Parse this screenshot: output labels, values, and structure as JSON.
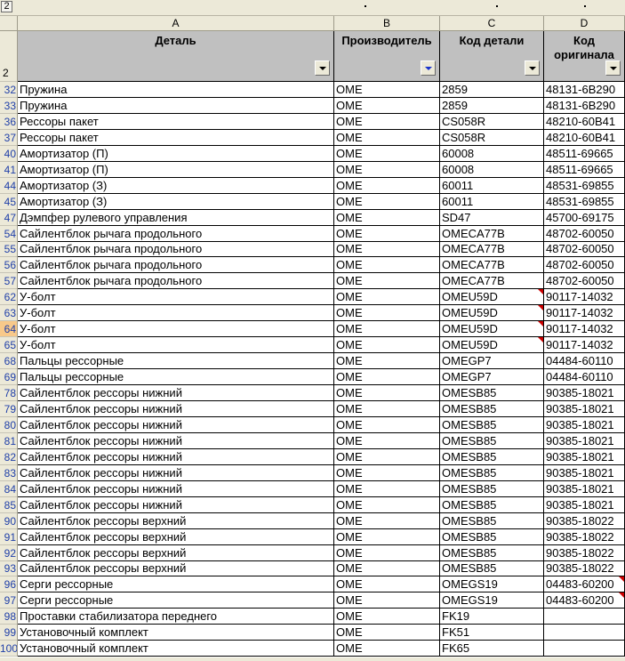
{
  "app": {
    "level_button": "2"
  },
  "columns": [
    "A",
    "B",
    "C",
    "D"
  ],
  "header_row_number": "2",
  "headers": [
    "Деталь",
    "Производитель",
    "Код детали",
    "Код оригинала"
  ],
  "rows": [
    {
      "n": "32",
      "a": "Пружина",
      "b": "OME",
      "c": "2859",
      "d": "48131-6B290"
    },
    {
      "n": "33",
      "a": "Пружина",
      "b": "OME",
      "c": "2859",
      "d": "48131-6B290"
    },
    {
      "n": "36",
      "a": "Рессоры пакет",
      "b": "OME",
      "c": "CS058R",
      "d": "48210-60B41"
    },
    {
      "n": "37",
      "a": "Рессоры пакет",
      "b": "OME",
      "c": "CS058R",
      "d": "48210-60B41"
    },
    {
      "n": "40",
      "a": "Амортизатор (П)",
      "b": "OME",
      "c": "60008",
      "d": "48511-69665"
    },
    {
      "n": "41",
      "a": "Амортизатор (П)",
      "b": "OME",
      "c": "60008",
      "d": "48511-69665"
    },
    {
      "n": "44",
      "a": "Амортизатор (З)",
      "b": "OME",
      "c": "60011",
      "d": "48531-69855"
    },
    {
      "n": "45",
      "a": "Амортизатор (З)",
      "b": "OME",
      "c": "60011",
      "d": "48531-69855"
    },
    {
      "n": "47",
      "a": "Дэмпфер рулевого управления",
      "b": "OME",
      "c": "SD47",
      "d": "45700-69175"
    },
    {
      "n": "54",
      "a": "Сайлентблок рычага продольного",
      "b": "OME",
      "c": "OMECA77B",
      "d": "48702-60050"
    },
    {
      "n": "55",
      "a": "Сайлентблок рычага продольного",
      "b": "OME",
      "c": "OMECA77B",
      "d": "48702-60050"
    },
    {
      "n": "56",
      "a": "Сайлентблок рычага продольного",
      "b": "OME",
      "c": "OMECA77B",
      "d": "48702-60050"
    },
    {
      "n": "57",
      "a": "Сайлентблок рычага продольного",
      "b": "OME",
      "c": "OMECA77B",
      "d": "48702-60050"
    },
    {
      "n": "62",
      "a": "У-болт",
      "b": "OME",
      "c": "OMEU59D",
      "d": "90117-14032"
    },
    {
      "n": "63",
      "a": "У-болт",
      "b": "OME",
      "c": "OMEU59D",
      "d": "90117-14032"
    },
    {
      "n": "64",
      "a": "У-болт",
      "b": "OME",
      "c": "OMEU59D",
      "d": "90117-14032"
    },
    {
      "n": "65",
      "a": "У-болт",
      "b": "OME",
      "c": "OMEU59D",
      "d": "90117-14032"
    },
    {
      "n": "68",
      "a": "Пальцы рессорные",
      "b": "OME",
      "c": "OMEGP7",
      "d": "04484-60110"
    },
    {
      "n": "69",
      "a": "Пальцы рессорные",
      "b": "OME",
      "c": "OMEGP7",
      "d": "04484-60110"
    },
    {
      "n": "78",
      "a": "Сайлентблок рессоры нижний",
      "b": "OME",
      "c": "OMESB85",
      "d": "90385-18021"
    },
    {
      "n": "79",
      "a": "Сайлентблок рессоры нижний",
      "b": "OME",
      "c": "OMESB85",
      "d": "90385-18021"
    },
    {
      "n": "80",
      "a": "Сайлентблок рессоры нижний",
      "b": "OME",
      "c": "OMESB85",
      "d": "90385-18021"
    },
    {
      "n": "81",
      "a": "Сайлентблок рессоры нижний",
      "b": "OME",
      "c": "OMESB85",
      "d": "90385-18021"
    },
    {
      "n": "82",
      "a": "Сайлентблок рессоры нижний",
      "b": "OME",
      "c": "OMESB85",
      "d": "90385-18021"
    },
    {
      "n": "83",
      "a": "Сайлентблок рессоры нижний",
      "b": "OME",
      "c": "OMESB85",
      "d": "90385-18021"
    },
    {
      "n": "84",
      "a": "Сайлентблок рессоры нижний",
      "b": "OME",
      "c": "OMESB85",
      "d": "90385-18021"
    },
    {
      "n": "85",
      "a": "Сайлентблок рессоры нижний",
      "b": "OME",
      "c": "OMESB85",
      "d": "90385-18021"
    },
    {
      "n": "90",
      "a": "Сайлентблок рессоры верхний",
      "b": "OME",
      "c": "OMESB85",
      "d": "90385-18022"
    },
    {
      "n": "91",
      "a": "Сайлентблок рессоры верхний",
      "b": "OME",
      "c": "OMESB85",
      "d": "90385-18022"
    },
    {
      "n": "92",
      "a": "Сайлентблок рессоры верхний",
      "b": "OME",
      "c": "OMESB85",
      "d": "90385-18022"
    },
    {
      "n": "93",
      "a": "Сайлентблок рессоры верхний",
      "b": "OME",
      "c": "OMESB85",
      "d": "90385-18022"
    },
    {
      "n": "96",
      "a": "Серги рессорные",
      "b": "OME",
      "c": "OMEGS19",
      "d": "04483-60200"
    },
    {
      "n": "97",
      "a": "Серги рессорные",
      "b": "OME",
      "c": "OMEGS19",
      "d": "04483-60200"
    },
    {
      "n": "98",
      "a": "Проставки стабилизатора переднего",
      "b": "OME",
      "c": "FK19",
      "d": ""
    },
    {
      "n": "99",
      "a": "Установочный комплект",
      "b": "OME",
      "c": "FK51",
      "d": ""
    },
    {
      "n": "100",
      "a": "Установочный комплект",
      "b": "OME",
      "c": "FK65",
      "d": ""
    }
  ],
  "active_row": "64",
  "comment_cells_c": [
    "62",
    "63",
    "64",
    "65"
  ],
  "comment_cells_d": [
    "96",
    "97"
  ],
  "active_filter_column": "B"
}
